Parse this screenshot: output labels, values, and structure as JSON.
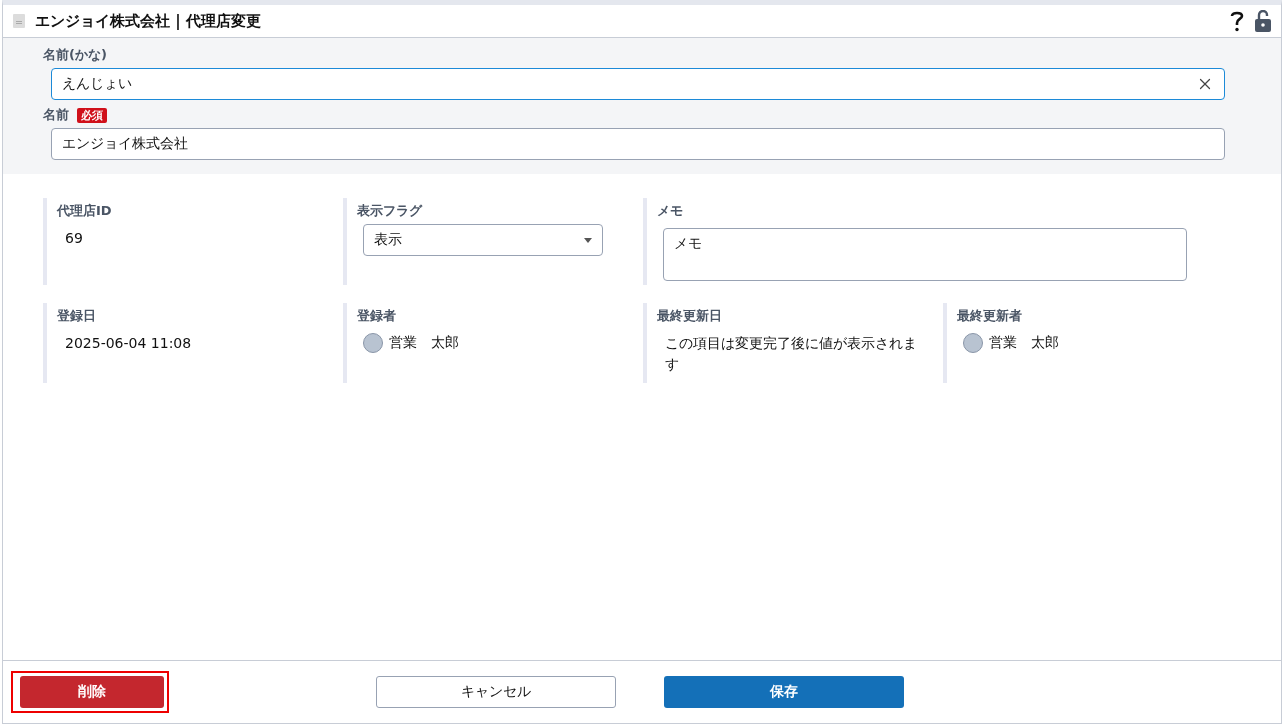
{
  "window": {
    "title": "エンジョイ株式会社 | 代理店変更"
  },
  "name_section": {
    "fields": [
      {
        "label": "名前(かな)",
        "value": "えんじょい",
        "focused": true,
        "clearable": true
      },
      {
        "label": "名前",
        "badge": "必須",
        "value": "エンジョイ株式会社",
        "focused": false,
        "clearable": false
      }
    ]
  },
  "details": [
    {
      "kind": "text",
      "label": "代理店ID",
      "value": "69"
    },
    {
      "kind": "select",
      "label": "表示フラグ",
      "value": "表示"
    },
    {
      "kind": "textarea",
      "label": "メモ",
      "placeholder": "メモ"
    },
    {
      "kind": "text",
      "label": "登録日",
      "value": "2025-06-04  11:08"
    },
    {
      "kind": "user",
      "label": "登録者",
      "value": "営業　太郎"
    },
    {
      "kind": "text",
      "label": "最終更新日",
      "value": "この項目は変更完了後に値が表示されます"
    },
    {
      "kind": "user",
      "label": "最終更新者",
      "value": "営業　太郎"
    }
  ],
  "footer": {
    "buttons": [
      {
        "kind": "danger",
        "label": "削除",
        "highlighted": true
      },
      {
        "kind": "secondary",
        "label": "キャンセル",
        "highlighted": false
      },
      {
        "kind": "primary",
        "label": "保存",
        "highlighted": false
      }
    ]
  }
}
